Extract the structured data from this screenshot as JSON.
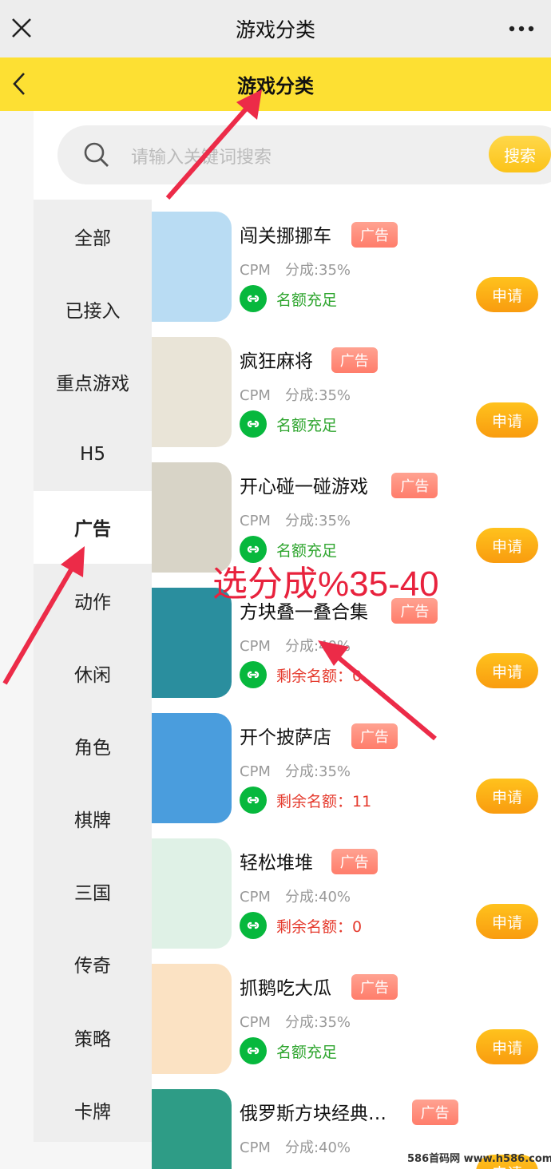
{
  "topbar": {
    "title": "游戏分类",
    "close_icon": "close-icon",
    "more_icon": "more-icon"
  },
  "header": {
    "title": "游戏分类",
    "back_icon": "back-icon"
  },
  "search": {
    "placeholder": "请输入关键词搜索",
    "button_label": "搜索"
  },
  "categories": [
    {
      "label": "全部"
    },
    {
      "label": "已接入"
    },
    {
      "label": "重点游戏"
    },
    {
      "label": "H5"
    },
    {
      "label": "广告",
      "active": true
    },
    {
      "label": "动作"
    },
    {
      "label": "休闲"
    },
    {
      "label": "角色"
    },
    {
      "label": "棋牌"
    },
    {
      "label": "三国"
    },
    {
      "label": "传奇"
    },
    {
      "label": "策略"
    },
    {
      "label": "卡牌"
    }
  ],
  "games": [
    {
      "name": "闯关挪挪车",
      "tag": "广告",
      "type": "CPM",
      "share": "分成:35%",
      "quota": "名额充足",
      "quota_status": "ok",
      "apply": "申请",
      "thumb_color": "#b9dcf3"
    },
    {
      "name": "疯狂麻将",
      "tag": "广告",
      "type": "CPM",
      "share": "分成:35%",
      "quota": "名额充足",
      "quota_status": "ok",
      "apply": "申请",
      "thumb_color": "#e9e4d7"
    },
    {
      "name": "开心碰一碰游戏",
      "tag": "广告",
      "type": "CPM",
      "share": "分成:35%",
      "quota": "名额充足",
      "quota_status": "ok",
      "apply": "申请",
      "thumb_color": "#d8d4c7"
    },
    {
      "name": "方块叠一叠合集",
      "tag": "广告",
      "type": "CPM",
      "share": "分成:40%",
      "quota": "剩余名额：0",
      "quota_status": "low",
      "apply": "申请",
      "thumb_color": "#2a8e9e"
    },
    {
      "name": "开个披萨店",
      "tag": "广告",
      "type": "CPM",
      "share": "分成:35%",
      "quota": "剩余名额：11",
      "quota_status": "low",
      "apply": "申请",
      "thumb_color": "#4a9ddd"
    },
    {
      "name": "轻松堆堆",
      "tag": "广告",
      "type": "CPM",
      "share": "分成:40%",
      "quota": "剩余名额：0",
      "quota_status": "low",
      "apply": "申请",
      "thumb_color": "#dff1e6"
    },
    {
      "name": "抓鹅吃大瓜",
      "tag": "广告",
      "type": "CPM",
      "share": "分成:35%",
      "quota": "名额充足",
      "quota_status": "ok",
      "apply": "申请",
      "thumb_color": "#fbe2c3"
    },
    {
      "name": "俄罗斯方块经典…",
      "tag": "广告",
      "type": "CPM",
      "share": "分成:40%",
      "quota": "",
      "quota_status": "ok",
      "apply": "申请",
      "thumb_color": "#2e9c86"
    }
  ],
  "annotation": {
    "text": "选分成%35-40",
    "color": "#e8223d"
  },
  "watermark": "586首码网 www.h586.com",
  "colors": {
    "brand_yellow": "#fde033",
    "apply_orange": "#f99c0f",
    "tag_red": "#ff7d6b",
    "wechat_green": "#07b83d"
  }
}
